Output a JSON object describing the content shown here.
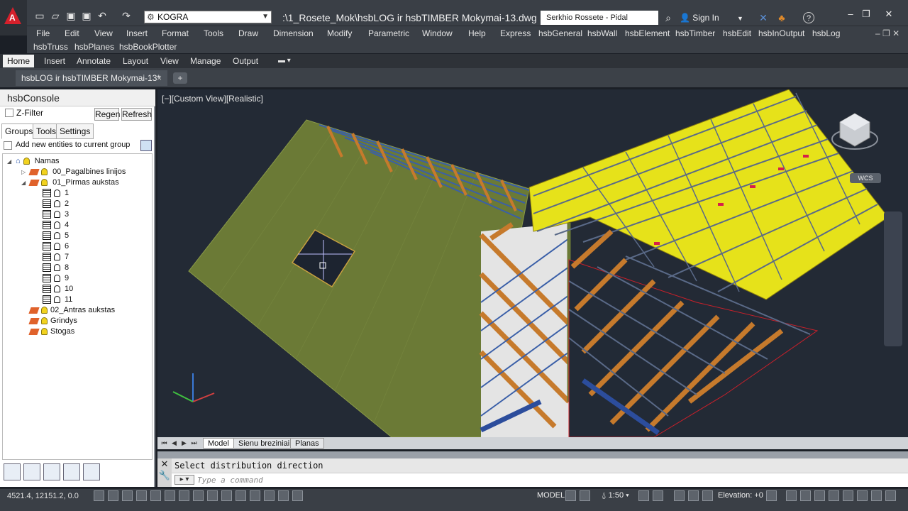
{
  "titlebar": {
    "workspace": "KOGRA",
    "doc_title": ":\\1_Rosete_Mok\\hsbLOG ir hsbTIMBER Mokymai-13.dwg",
    "search_text": "Serkhio  Rossete - Pidal",
    "signin": "Sign In",
    "help": "?",
    "logo_letter": "A"
  },
  "menu": {
    "row1": [
      "File",
      "Edit",
      "View",
      "Insert",
      "Format",
      "Tools",
      "Draw",
      "Dimension",
      "Modify",
      "Parametric",
      "Window",
      "Help",
      "Express",
      "hsbGeneral",
      "hsbWall",
      "hsbElement",
      "hsbTimber",
      "hsbEdit",
      "hsbInOutput",
      "hsbLog"
    ],
    "row2": [
      "hsbTruss",
      "hsbPlanes",
      "hsbBookPlotter"
    ]
  },
  "ribbon_tabs": [
    "Home",
    "Insert",
    "Annotate",
    "Layout",
    "View",
    "Manage",
    "Output"
  ],
  "doc_tab": {
    "label": "hsbLOG ir hsbTIMBER Mokymai-13*",
    "close": "×",
    "new": "+"
  },
  "console": {
    "title": "hsbConsole",
    "zfilter": "Z-Filter",
    "regen": "Regen",
    "refresh": "Refresh",
    "tabs": [
      "Groups",
      "Tools",
      "Settings"
    ],
    "add_new": "Add new entities to current group",
    "tree": {
      "root": "Namas",
      "top_groups": [
        "00_Pagalbines linijos",
        "01_Pirmas aukstas"
      ],
      "subgroups": [
        "1",
        "2",
        "3",
        "4",
        "5",
        "6",
        "7",
        "8",
        "9",
        "10",
        "11"
      ],
      "rest": [
        "02_Antras aukstas",
        "Grindys",
        "Stogas"
      ]
    }
  },
  "viewport": {
    "label": "[−][Custom View][Realistic]",
    "wcs": "WCS"
  },
  "layout_tabs": [
    "Model",
    "Sienu breziniai",
    "Planas"
  ],
  "command": {
    "history": "Select distribution direction",
    "placeholder": "Type a command"
  },
  "status": {
    "coords": "4521.4, 12151.2, 0.0",
    "model": "MODEL",
    "scale": "1:50",
    "elevation": "Elevation: +0"
  },
  "colors": {
    "roof_green": "#6b7a36",
    "roof_yellow": "#e6e21a",
    "timber_orange": "#d17a2a",
    "batten_blue": "#2c4d9c",
    "viewport_bg": "#232a35"
  }
}
